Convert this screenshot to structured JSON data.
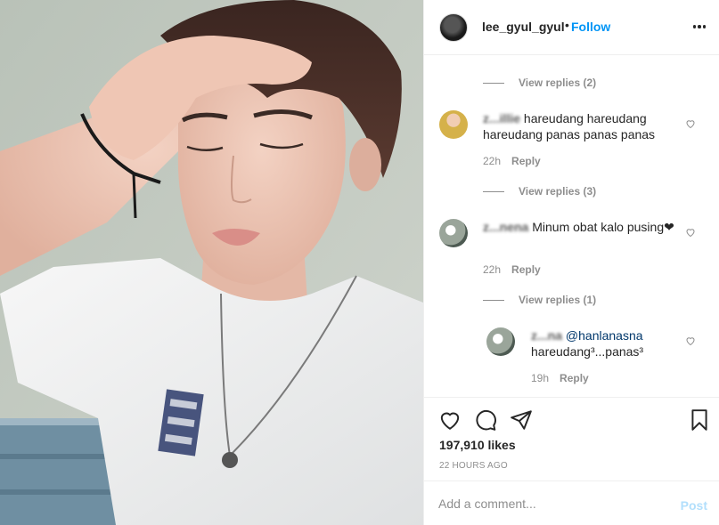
{
  "post": {
    "username": "lee_gyul_gyul",
    "dot": "•",
    "follow_label": "Follow",
    "more_icon": "more-options-icon"
  },
  "comments": [
    {
      "type": "view_replies",
      "label": "View replies (2)"
    },
    {
      "type": "comment",
      "user": "z...illie",
      "text": "hareudang hareudang hareudang panas panas panas",
      "time": "22h",
      "reply_label": "Reply"
    },
    {
      "type": "view_replies",
      "label": "View replies (3)"
    },
    {
      "type": "comment",
      "user": "z...nena",
      "text": "Minum obat kalo pusing❤",
      "time": "22h",
      "reply_label": "Reply"
    },
    {
      "type": "view_replies",
      "label": "View replies (1)"
    },
    {
      "type": "reply",
      "user": "z...na",
      "mention": "@hanlanasna",
      "text": "hareudang³...panas³",
      "time": "19h",
      "reply_label": "Reply"
    }
  ],
  "actions": {
    "like_icon": "heart-icon",
    "comment_icon": "comment-icon",
    "share_icon": "share-icon",
    "save_icon": "bookmark-icon",
    "likes": "197,910 likes",
    "time_ago": "22 HOURS AGO"
  },
  "add_comment": {
    "placeholder": "Add a comment...",
    "post_label": "Post"
  },
  "colors": {
    "link": "#0095f6",
    "mention": "#00376b",
    "muted": "#8e8e8e",
    "post_disabled": "#b2dffc"
  }
}
